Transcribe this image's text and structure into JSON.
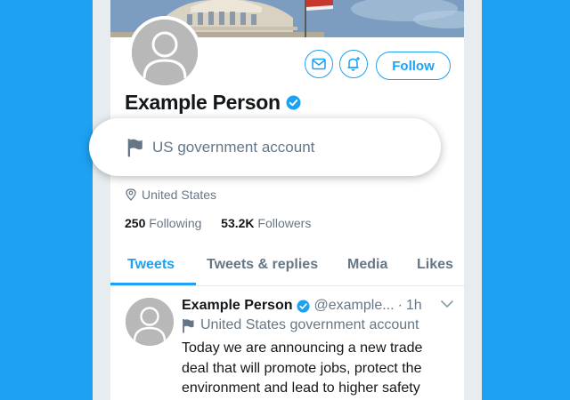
{
  "profile": {
    "name": "Example Person",
    "label": "US government account",
    "location": "United States",
    "following_count": "250",
    "following_label": "Following",
    "followers_count": "53.2K",
    "followers_label": "Followers",
    "follow_label": "Follow"
  },
  "tabs": [
    {
      "label": "Tweets",
      "active": true
    },
    {
      "label": "Tweets & replies",
      "active": false
    },
    {
      "label": "Media",
      "active": false
    },
    {
      "label": "Likes",
      "active": false
    }
  ],
  "tweet": {
    "name": "Example Person",
    "handle": "@example...",
    "separator": "·",
    "time": "1h",
    "label": "United States government account",
    "text": "Today we are announcing a new trade deal that will promote jobs, protect the environment and lead to higher safety"
  },
  "colors": {
    "brand": "#1da1f2",
    "text": "#14171a",
    "secondary": "#657786"
  },
  "icons": [
    "mail-icon",
    "notification-bell-icon",
    "verified-badge-icon",
    "flag-icon",
    "location-pin-icon",
    "chevron-down-icon",
    "avatar-placeholder-icon"
  ]
}
